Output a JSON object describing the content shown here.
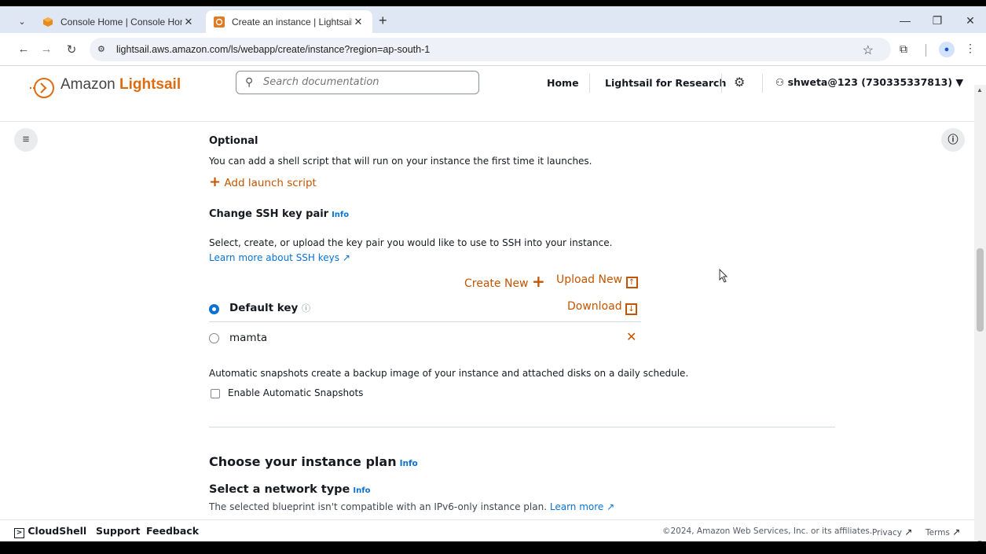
{
  "browser": {
    "tabs": [
      {
        "title": "Console Home | Console Home",
        "active": false
      },
      {
        "title": "Create an instance | Lightsail",
        "active": true
      }
    ],
    "url": "lightsail.aws.amazon.com/ls/webapp/create/instance?region=ap-south-1"
  },
  "header": {
    "logo_prefix": "Amazon",
    "logo_brand": "Lightsail",
    "search_placeholder": "Search documentation",
    "nav": [
      "Home",
      "Lightsail for Research"
    ],
    "user": "shweta@123 (730335337813)"
  },
  "launch_script": {
    "heading": "Optional",
    "description": "You can add a shell script that will run on your instance the first time it launches.",
    "add_label": "Add launch script"
  },
  "ssh": {
    "heading": "Change SSH key pair",
    "info": "Info",
    "description": "Select, create, or upload the key pair you would like to use to SSH into your instance.",
    "learn_more": "Learn more about SSH keys",
    "create_new": "Create New",
    "upload_new": "Upload New",
    "keys": [
      {
        "name": "Default key",
        "selected": true,
        "action": "Download"
      },
      {
        "name": "mamta",
        "selected": false,
        "action": "delete"
      }
    ]
  },
  "snapshots": {
    "description": "Automatic snapshots create a backup image of your instance and attached disks on a daily schedule.",
    "enable_label": "Enable Automatic Snapshots",
    "enabled": false
  },
  "plan": {
    "heading": "Choose your instance plan",
    "info": "Info",
    "network_heading": "Select a network type",
    "network_info": "Info",
    "network_note": "The selected blueprint isn't compatible with an IPv6-only instance plan.",
    "learn_more": "Learn more"
  },
  "footer": {
    "cloudshell": "CloudShell",
    "support": "Support",
    "feedback": "Feedback",
    "copyright": "©2024, Amazon Web Services, Inc. or its affiliates.",
    "privacy": "Privacy",
    "terms": "Terms"
  },
  "colors": {
    "accent": "#dd6b10",
    "link": "#0972d3",
    "action": "#c45500"
  }
}
